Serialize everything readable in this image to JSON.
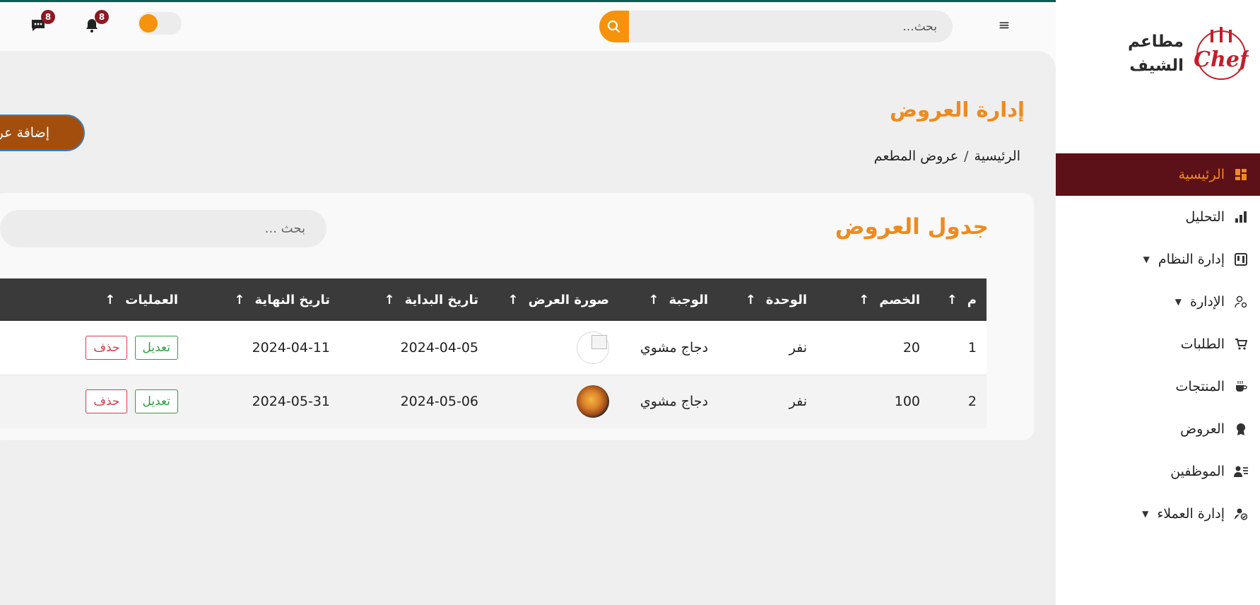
{
  "brand": {
    "name": "مطاعم الشيف",
    "logo_text": "Chef"
  },
  "sidebar": {
    "items": [
      {
        "label": "الرئيسية",
        "icon": "dashboard-icon",
        "active": true
      },
      {
        "label": "التحليل",
        "icon": "bar-chart-icon"
      },
      {
        "label": "إدارة النظام",
        "icon": "system-icon",
        "caret": true
      },
      {
        "label": "الإدارة",
        "icon": "user-gear-icon",
        "caret": true
      },
      {
        "label": "الطلبات",
        "icon": "cart-icon"
      },
      {
        "label": "المنتجات",
        "icon": "coffee-cup-icon"
      },
      {
        "label": "العروض",
        "icon": "award-icon"
      },
      {
        "label": "الموظفين",
        "icon": "employee-list-icon"
      },
      {
        "label": "إدارة العملاء",
        "icon": "user-check-icon",
        "caret": true
      }
    ]
  },
  "topbar": {
    "search_placeholder": "بحث...",
    "notifications_count": "8",
    "messages_count": "8"
  },
  "page": {
    "title": "إدارة العروض",
    "breadcrumb": {
      "home": "الرئيسية",
      "separator": "/",
      "current": "عروض المطعم"
    },
    "add_button": "إضافة عرض"
  },
  "table": {
    "title": "جدول العروض",
    "search_placeholder": "بحث ...",
    "columns": [
      "م",
      "الخصم",
      "الوحدة",
      "الوجبة",
      "صورة العرض",
      "تاريخ البداية",
      "تاريخ النهاية",
      "العمليات"
    ],
    "sort_arrow": "↑",
    "edit_label": "تعديل",
    "delete_label": "حذف",
    "rows": [
      {
        "index": "1",
        "discount": "20",
        "unit": "نفر",
        "meal": "دجاج مشوي",
        "start": "2024-04-05",
        "end": "2024-04-11"
      },
      {
        "index": "2",
        "discount": "100",
        "unit": "نفر",
        "meal": "دجاج مشوي",
        "start": "2024-05-06",
        "end": "2024-05-31"
      }
    ]
  },
  "colors": {
    "accent": "#f08a1c",
    "active_nav": "#5c1018",
    "button": "#a44e0e",
    "header": "#3a3a3a"
  }
}
